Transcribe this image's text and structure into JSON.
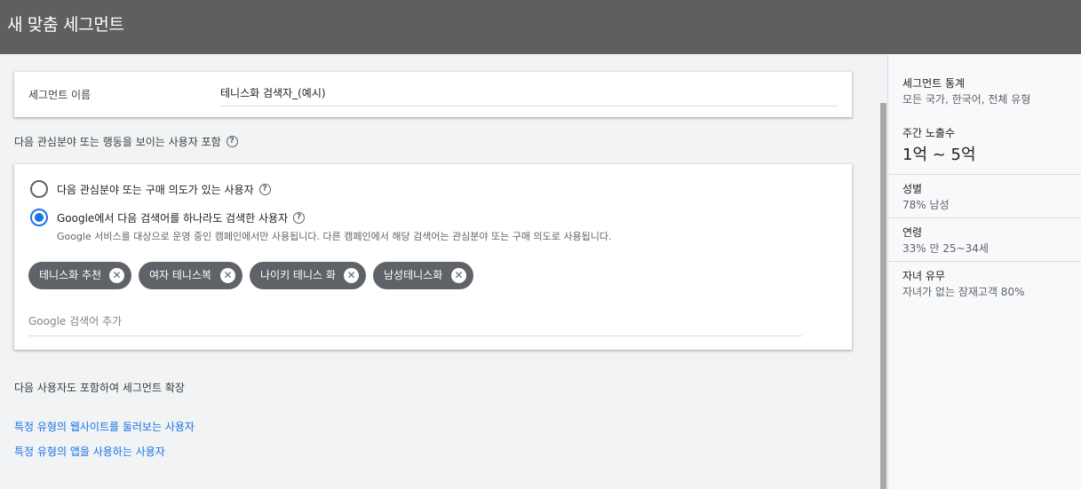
{
  "header": {
    "title": "새 맞춤 세그먼트"
  },
  "segment_name": {
    "label": "세그먼트 이름",
    "value": "테니스화 검색자_(예시)"
  },
  "include_section": {
    "title": "다음 관심분야 또는 행동을 보이는 사용자 포함"
  },
  "options": {
    "interest": {
      "label": "다음 관심분야 또는 구매 의도가 있는 사용자",
      "selected": false
    },
    "search": {
      "label": "Google에서 다음 검색어를 하나라도 검색한 사용자",
      "description": "Google 서비스를 대상으로 운영 중인 캠페인에서만 사용됩니다. 다른 캠페인에서 해당 검색어는 관심분야 또는 구매 의도로 사용됩니다.",
      "selected": true
    }
  },
  "chips": [
    "테니스화 추천",
    "여자 테니스복",
    "나이키 테니스 화",
    "남성테니스화"
  ],
  "search_input": {
    "placeholder": "Google 검색어 추가"
  },
  "expand": {
    "title": "다음 사용자도 포함하여 세그먼트 확장",
    "links": [
      "특정 유형의 웹사이트를 둘러보는 사용자",
      "특정 유형의 앱을 사용하는 사용자"
    ]
  },
  "stats": {
    "segment": {
      "title": "세그먼트 통계",
      "value": "모든 국가, 한국어, 전체 유형"
    },
    "impressions": {
      "title": "주간 노출수",
      "value": "1억 ~ 5억"
    },
    "gender": {
      "title": "성별",
      "value": "78% 남성"
    },
    "age": {
      "title": "연령",
      "value": "33% 만 25~34세"
    },
    "parental": {
      "title": "자녀 유무",
      "value": "자녀가 없는 잠재고객 80%"
    }
  },
  "colors": {
    "header_bg": "#5f5f5f",
    "accent": "#1a73e8",
    "chip_bg": "#5f6368"
  }
}
